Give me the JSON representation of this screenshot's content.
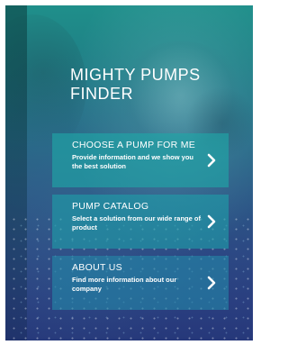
{
  "app": {
    "title": "MIGHTY PUMPS\nFINDER"
  },
  "menu": {
    "items": [
      {
        "title": "CHOOSE A PUMP FOR ME",
        "description": "Provide information and we show you the best solution",
        "icon": "chevron-right-icon"
      },
      {
        "title": "PUMP CATALOG",
        "description": "Select a solution from our wide range of product",
        "icon": "chevron-right-icon"
      },
      {
        "title": "ABOUT US",
        "description": "Find more information about our company",
        "icon": "chevron-right-icon"
      }
    ]
  },
  "colors": {
    "accent": "#1EA8A8",
    "text": "#FFFFFF",
    "background_top": "#1F8F8A",
    "background_bottom": "#26387A"
  }
}
